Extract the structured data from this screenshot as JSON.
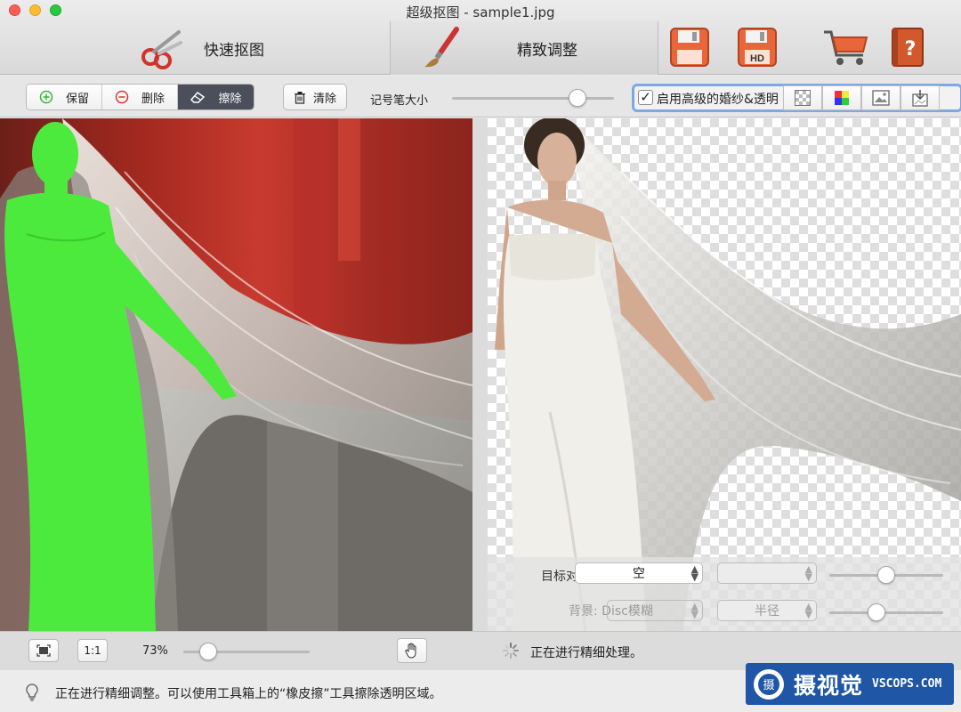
{
  "window": {
    "title": "超级抠图 - sample1.jpg"
  },
  "tabs": {
    "quick": "快速抠图",
    "fine": "精致调整"
  },
  "toolbar": {
    "keep": "保留",
    "delete": "删除",
    "erase": "擦除",
    "clear": "清除",
    "brush_size_label": "记号笔大小",
    "brush_size_level": 0.81,
    "advanced_checkbox_label": "启用高级的婚纱&透明",
    "advanced_checked": true
  },
  "overlay": {
    "target_label": "目标对",
    "target_value": "空",
    "background_label": "背景: Disc模糊",
    "radius_label": "半径",
    "slider1_level": 0.5,
    "slider2_level": 0.4
  },
  "bottom": {
    "fit_label": "",
    "one_to_one": "1:1",
    "zoom": "73%",
    "zoom_level": 0.15,
    "progress_text": "正在进行精细处理。"
  },
  "status": {
    "message": "正在进行精细调整。可以使用工具箱上的“橡皮擦”工具擦除透明区域。"
  },
  "watermark": {
    "brand": "摄视觉",
    "site": "VSCOPS.COM"
  },
  "colors": {
    "accent": "#7ea7e6",
    "mask_green": "#4cea3c",
    "brand_blue": "#1f56a6"
  }
}
